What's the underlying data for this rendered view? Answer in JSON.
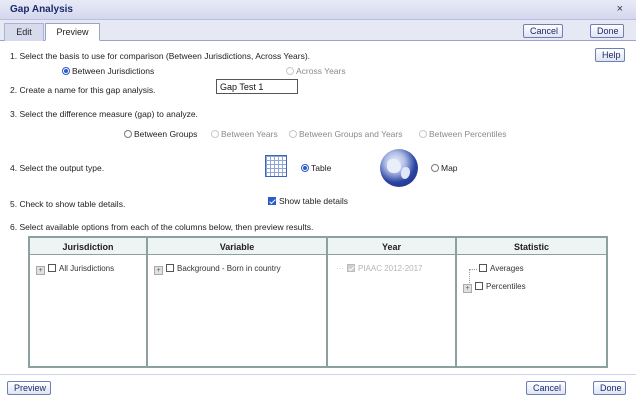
{
  "window": {
    "title": "Gap Analysis",
    "close_glyph": "×"
  },
  "tabs": [
    {
      "label": "Edit",
      "active": false
    },
    {
      "label": "Preview",
      "active": true
    }
  ],
  "top_buttons": {
    "cancel": "Cancel",
    "done": "Done"
  },
  "help_button": "Help",
  "steps": {
    "s1": {
      "num": "1.",
      "text": "Select the basis to use for comparison (Between Jurisdictions, Across Years).",
      "options": [
        {
          "label": "Between Jurisdictions",
          "selected": true,
          "enabled": true
        },
        {
          "label": "Across Years",
          "selected": false,
          "enabled": false
        }
      ]
    },
    "s2": {
      "num": "2.",
      "text": "Create a name for this gap analysis.",
      "value": "Gap Test 1"
    },
    "s3": {
      "num": "3.",
      "text": "Select the difference measure (gap) to analyze.",
      "options": [
        {
          "label": "Between Groups",
          "selected": false,
          "enabled": true
        },
        {
          "label": "Between Years",
          "selected": false,
          "enabled": false
        },
        {
          "label": "Between Groups and Years",
          "selected": false,
          "enabled": false
        },
        {
          "label": "Between Percentiles",
          "selected": false,
          "enabled": false
        }
      ]
    },
    "s4": {
      "num": "4.",
      "text": "Select the output type.",
      "table_label": "Table",
      "map_label": "Map",
      "table_icon": "table-grid-icon",
      "map_icon": "globe-map-icon",
      "selected": "Table"
    },
    "s5": {
      "num": "5.",
      "text": "Check to show table details.",
      "checkbox_label": "Show table details",
      "checked": true
    },
    "s6": {
      "num": "6.",
      "text": "Select available options from each of the columns below, then preview results."
    }
  },
  "columns": {
    "jurisdiction": {
      "header": "Jurisdiction",
      "items": [
        {
          "label": "All Jurisdictions",
          "checked": false
        }
      ]
    },
    "variable": {
      "header": "Variable",
      "items": [
        {
          "label": "Background - Born in country",
          "checked": false
        }
      ]
    },
    "year": {
      "header": "Year",
      "items": [
        {
          "label": "PIAAC 2012-2017",
          "checked": true,
          "disabled": true
        }
      ]
    },
    "statistic": {
      "header": "Statistic",
      "items": [
        {
          "label": "Averages",
          "checked": false
        },
        {
          "label": "Percentiles",
          "checked": false
        }
      ]
    }
  },
  "bottom_buttons": {
    "preview": "Preview",
    "cancel": "Cancel",
    "done": "Done"
  },
  "colors": {
    "accent": "#2b5cc9",
    "title_text": "#1a2a6c",
    "table_border": "#8da0a0"
  }
}
